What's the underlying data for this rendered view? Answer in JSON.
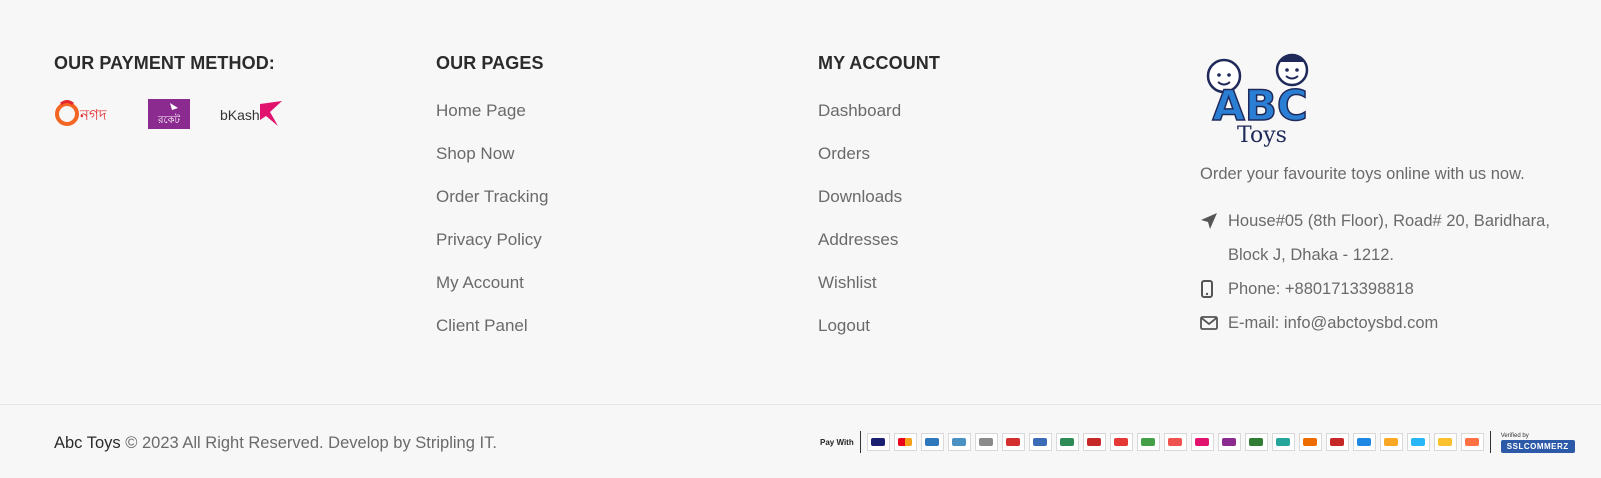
{
  "payment": {
    "title": "OUR PAYMENT METHOD:",
    "logos": [
      {
        "name": "nagad-logo",
        "text": "নগদ",
        "color": "#e2282c"
      },
      {
        "name": "rocket-logo",
        "text": "রকেট",
        "color": "#8b2b8f"
      },
      {
        "name": "bkash-logo",
        "text": "bKash",
        "color": "#e2136e"
      }
    ]
  },
  "pages": {
    "title": "OUR PAGES",
    "items": [
      "Home Page",
      "Shop Now",
      "Order Tracking",
      "Privacy Policy",
      "My Account",
      "Client Panel"
    ]
  },
  "account": {
    "title": "MY ACCOUNT",
    "items": [
      "Dashboard",
      "Orders",
      "Downloads",
      "Addresses",
      "Wishlist",
      "Logout"
    ]
  },
  "info": {
    "logo_text_abc": "ABC",
    "logo_text_toys": "Toys",
    "tagline": "Order your favourite toys online with us now.",
    "address": "House#05 (8th Floor), Road# 20, Baridhara, Block J, Dhaka - 1212.",
    "phone": "Phone: +8801713398818",
    "email": "E-mail: info@abctoysbd.com"
  },
  "bottom": {
    "brand": "Abc Toys",
    "copyright": " © 2023 All Right Reserved. Develop by Stripling IT.",
    "pay_with": "Pay With",
    "verified_by": "Verified by",
    "ssl_label": "SSLCOMMERZ"
  },
  "colors": {
    "heading": "#2b2b2b",
    "text": "#6a6a6a",
    "background": "#f7f7f7"
  }
}
